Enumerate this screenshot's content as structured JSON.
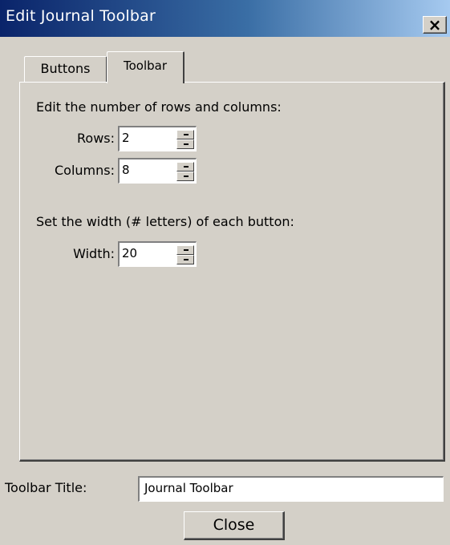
{
  "window": {
    "title": "Edit Journal Toolbar",
    "close_glyph": "×"
  },
  "tabs": [
    {
      "label": "Buttons",
      "selected": false
    },
    {
      "label": "Toolbar",
      "selected": true
    }
  ],
  "panel": {
    "rows_cols_heading": "Edit the number of rows and columns:",
    "rows_label": "Rows:",
    "rows_value": "2",
    "columns_label": "Columns:",
    "columns_value": "8",
    "width_heading": "Set the width (# letters) of each button:",
    "width_label": "Width:",
    "width_value": "20"
  },
  "footer": {
    "toolbar_title_label": "Toolbar Title:",
    "toolbar_title_value": "Journal Toolbar",
    "close_label": "Close"
  },
  "colors": {
    "face": "#d4d0c8",
    "title_gradient_start": "#0a246a",
    "title_gradient_end": "#a6caf0"
  },
  "icons": {
    "spin_up": "spin-up-arrow-icon",
    "spin_down": "spin-down-arrow-icon",
    "close": "close-icon"
  }
}
